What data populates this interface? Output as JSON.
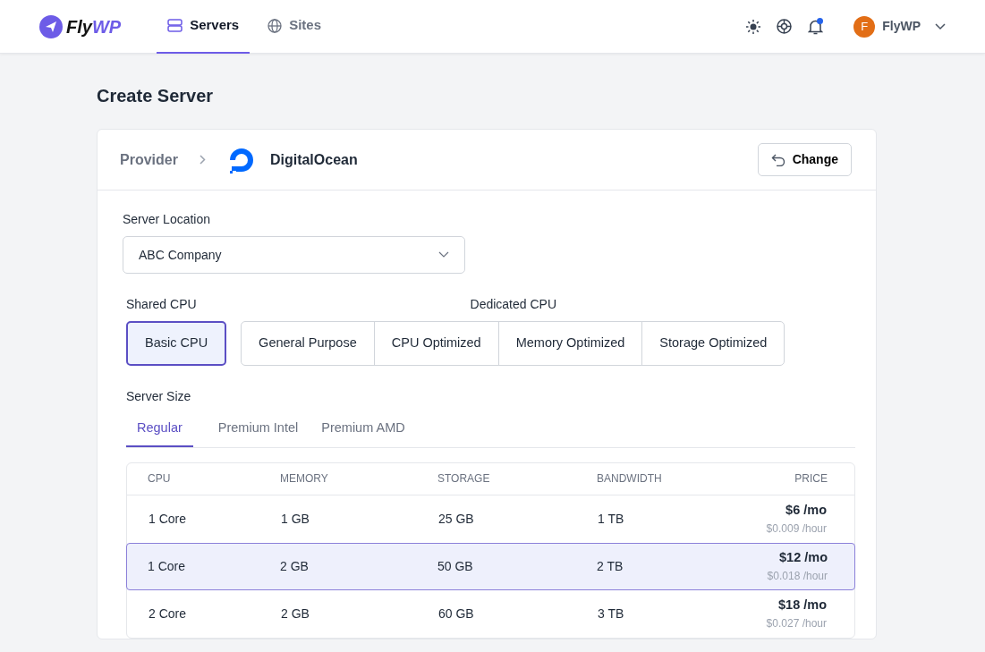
{
  "brand": {
    "first": "Fly",
    "second": "WP"
  },
  "nav": [
    {
      "label": "Servers",
      "selected": true
    },
    {
      "label": "Sites",
      "selected": false
    }
  ],
  "notifications": {
    "unread": true
  },
  "user": {
    "initial": "F",
    "name": "FlyWP"
  },
  "page_title": "Create Server",
  "provider": {
    "label": "Provider",
    "name": "DigitalOcean",
    "change_button": "Change"
  },
  "location": {
    "label": "Server Location",
    "value": "ABC Company"
  },
  "cpu_groups": [
    {
      "label": "Shared CPU",
      "options": [
        {
          "label": "Basic CPU",
          "selected": true
        }
      ]
    },
    {
      "label": "Dedicated CPU",
      "options": [
        {
          "label": "General Purpose",
          "selected": false
        },
        {
          "label": "CPU Optimized",
          "selected": false
        },
        {
          "label": "Memory Optimized",
          "selected": false
        },
        {
          "label": "Storage Optimized",
          "selected": false
        }
      ]
    }
  ],
  "size": {
    "label": "Server Size",
    "tabs": [
      {
        "label": "Regular",
        "selected": true
      },
      {
        "label": "Premium Intel",
        "selected": false
      },
      {
        "label": "Premium AMD",
        "selected": false
      }
    ]
  },
  "table": {
    "columns": [
      "CPU",
      "MEMORY",
      "STORAGE",
      "BANDWIDTH",
      "PRICE"
    ],
    "rows": [
      {
        "cpu": "1 Core",
        "memory": "1 GB",
        "storage": "25 GB",
        "bandwidth": "1 TB",
        "monthly": "$6 /mo",
        "hourly": "$0.009 /hour",
        "selected": false
      },
      {
        "cpu": "1 Core",
        "memory": "2 GB",
        "storage": "50 GB",
        "bandwidth": "2 TB",
        "monthly": "$12 /mo",
        "hourly": "$0.018 /hour",
        "selected": true
      },
      {
        "cpu": "2 Core",
        "memory": "2 GB",
        "storage": "60 GB",
        "bandwidth": "3 TB",
        "monthly": "$18 /mo",
        "hourly": "$0.027 /hour",
        "selected": false
      }
    ]
  }
}
